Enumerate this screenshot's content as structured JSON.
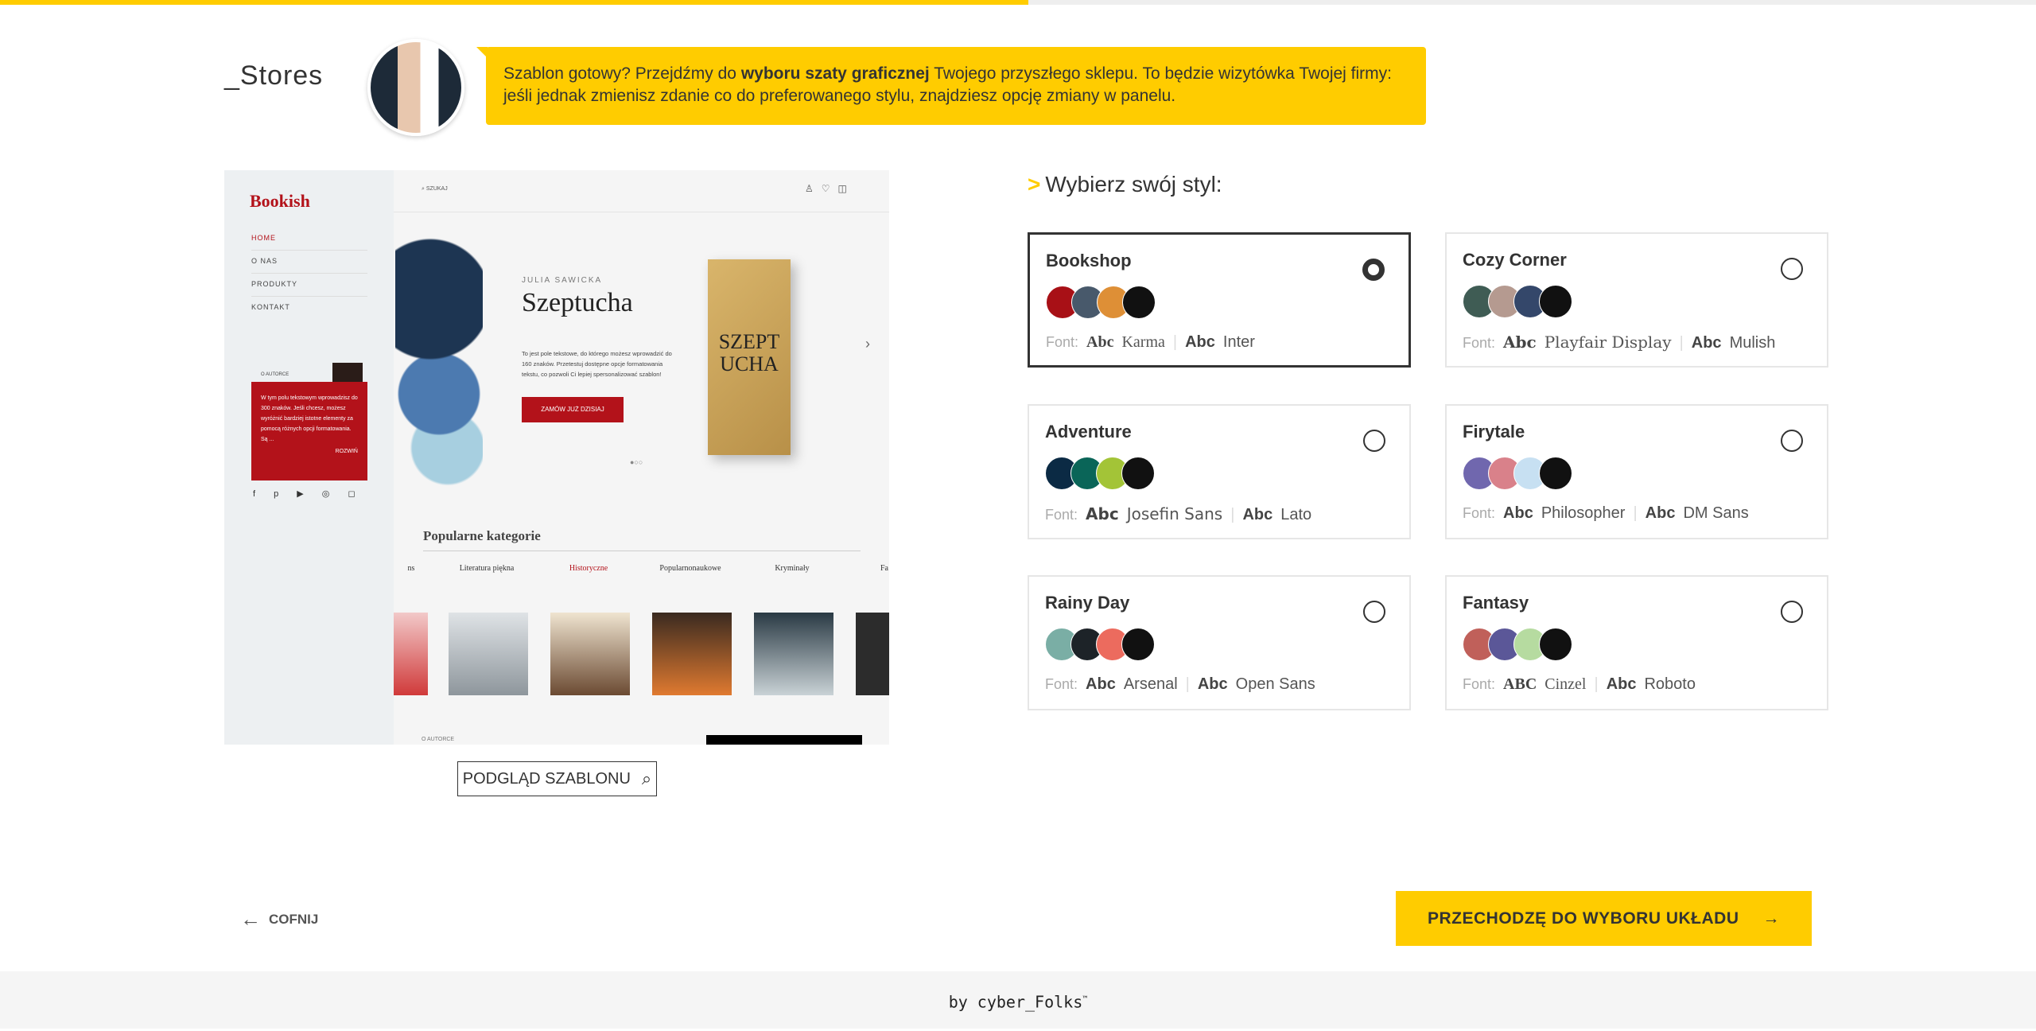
{
  "progress": {
    "percent": 50.5,
    "color": "#ffcc00"
  },
  "header": {
    "logo": "_Stores"
  },
  "bubble": {
    "pre": "Szablon gotowy? Przejdźmy do ",
    "bold": "wyboru szaty graficznej",
    "post": " Twojego przyszłego sklepu. To będzie wizytówka Twojej firmy: jeśli jednak zmienisz zdanie co do preferowanego stylu, znajdziesz opcję zmiany w panelu."
  },
  "preview": {
    "brand": "Bookish",
    "search": "SZUKAJ",
    "nav": [
      "HOME",
      "O NAS",
      "PRODUKTY",
      "KONTAKT"
    ],
    "about_label": "O AUTORCE",
    "about_text": "W tym polu tekstowym wprowadzisz do 300 znaków. Jeśli chcesz, możesz wyróżnić bardziej istotne elementy za pomocą różnych opcji formatowania. Są ...",
    "expand": "ROZWIŃ",
    "hero_author": "JULIA SAWICKA",
    "hero_title": "Szeptucha",
    "hero_text": "To jest pole tekstowe, do którego możesz wprowadzić do 160 znaków. Przetestuj dostępne opcje formatowania tekstu, co pozwoli Ci lepiej spersonalizować szablon!",
    "hero_cta": "ZAMÓW JUŻ DZISIAJ",
    "book_cover": "SZEPT UCHA",
    "categories_title": "Popularne kategorie",
    "categories": [
      "ns",
      "Literatura piękna",
      "Historyczne",
      "Popularnonaukowe",
      "Kryminały",
      "Fa"
    ],
    "footer_label": "O AUTORCE",
    "button": "PODGLĄD SZABLONU"
  },
  "styles": {
    "heading_marker": ">",
    "heading": "Wybierz swój styl:",
    "font_label": "Font:",
    "sample": "Abc",
    "items": [
      {
        "name": "Bookshop",
        "selected": true,
        "colors": [
          "#a81016",
          "#48596b",
          "#de8f36",
          "#111111"
        ],
        "font1": "Karma",
        "font2": "Inter"
      },
      {
        "name": "Cozy Corner",
        "selected": false,
        "colors": [
          "#3f5c54",
          "#b59a90",
          "#34476a",
          "#111111"
        ],
        "font1": "Playfair Display",
        "font2": "Mulish"
      },
      {
        "name": "Adventure",
        "selected": false,
        "colors": [
          "#0b2a44",
          "#0a6558",
          "#a3c437",
          "#111111"
        ],
        "font1": "Josefin Sans",
        "font2": "Lato"
      },
      {
        "name": "Firytale",
        "selected": false,
        "colors": [
          "#7067ae",
          "#d9818a",
          "#c7e0f2",
          "#111111"
        ],
        "font1": "Philosopher",
        "font2": "DM Sans"
      },
      {
        "name": "Rainy Day",
        "selected": false,
        "colors": [
          "#7aaea5",
          "#1d2328",
          "#ec6b5e",
          "#111111"
        ],
        "font1": "Arsenal",
        "font2": "Open Sans"
      },
      {
        "name": "Fantasy",
        "selected": false,
        "colors": [
          "#c0605a",
          "#5b5798",
          "#b6dba0",
          "#111111"
        ],
        "font1": "Cinzel",
        "font2": "Roboto",
        "sample1": "ABC"
      }
    ]
  },
  "nav": {
    "back": "COFNIJ",
    "next": "PRZECHODZĘ DO WYBORU UKŁADU"
  },
  "footer": {
    "text": "by cyber_Folks",
    "tm": "™"
  }
}
